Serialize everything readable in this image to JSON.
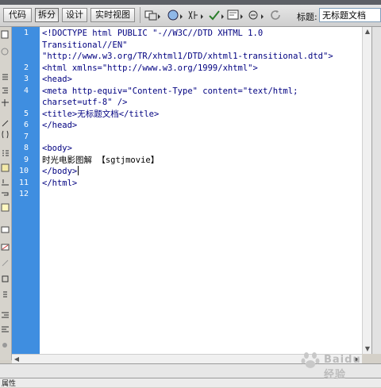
{
  "toolbar": {
    "views": [
      "代码",
      "拆分",
      "设计",
      "实时视图"
    ],
    "active_view": "拆分",
    "title_label": "标题:",
    "title_value": "无标题文档"
  },
  "editor": {
    "line_numbers": [
      "1",
      "2",
      "3",
      "4",
      "5",
      "6",
      "7",
      "8",
      "9",
      "10",
      "11",
      "12"
    ],
    "lines": [
      "<!DOCTYPE html PUBLIC \"-//W3C//DTD XHTML 1.0",
      "Transitional//EN\"",
      "\"http://www.w3.org/TR/xhtml1/DTD/xhtml1-transitional.dtd\">",
      "<html xmlns=\"http://www.w3.org/1999/xhtml\">",
      "<head>",
      "<meta http-equiv=\"Content-Type\" content=\"text/html;",
      "charset=utf-8\" />",
      "<title>无标题文档</title>",
      "</head>",
      "",
      "<body>",
      "时光电影图解 【sgtjmovie】",
      "</body>",
      "</html>"
    ]
  },
  "bottom_panel": {
    "tab_label": "属性"
  },
  "watermark": {
    "text": "Baidu 经验"
  },
  "colors": {
    "gutter": "#3f8ee0",
    "code_tag": "#000080",
    "background": "#d4d0c8"
  }
}
